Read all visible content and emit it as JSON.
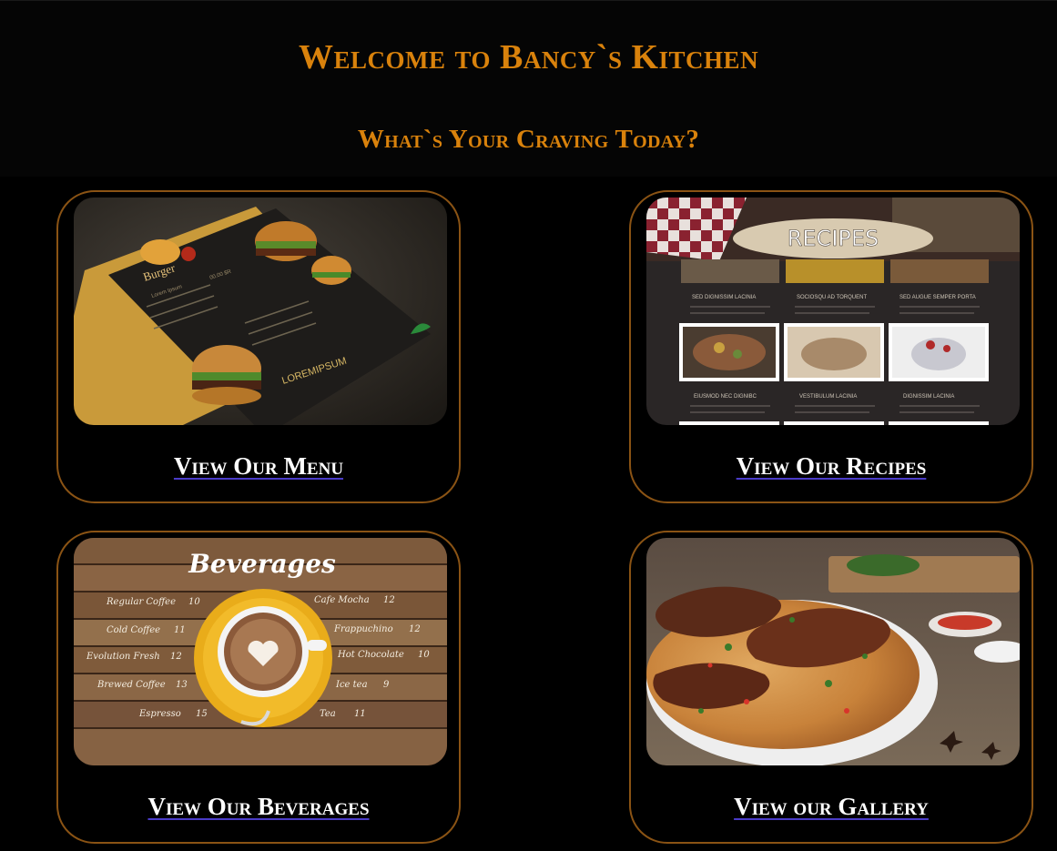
{
  "header": {
    "title": "Welcome to Bancy`s Kitchen",
    "subtitle": "What`s Your Craving Today?"
  },
  "cards": [
    {
      "label": "View Our Menu",
      "image_text": {
        "heading": "Burger",
        "brand": "LOREMIPSUM",
        "item": "Lorem Ipsum",
        "price": "00.00 $R"
      }
    },
    {
      "label": "View Our Recipes",
      "image_text": {
        "heading": "RECIPES",
        "captions": [
          "SED DIGNISSIM LACINIA",
          "SOCIOSQU AD TORQUENT",
          "SED AUGUE SEMPER PORTA",
          "EIUSMOD NEC DIGNIBC",
          "VESTIBULUM LACINIA",
          "DIGNISSIM LACINIA"
        ]
      }
    },
    {
      "label": "View Our Beverages",
      "image_text": {
        "heading": "Beverages",
        "items_left": [
          {
            "name": "Regular Coffee",
            "price": "10"
          },
          {
            "name": "Cold Coffee",
            "price": "11"
          },
          {
            "name": "Evolution Fresh",
            "price": "12"
          },
          {
            "name": "Brewed Coffee",
            "price": "13"
          },
          {
            "name": "Espresso",
            "price": "15"
          }
        ],
        "items_right": [
          {
            "name": "Cafe Mocha",
            "price": "12"
          },
          {
            "name": "Frappuchino",
            "price": "12"
          },
          {
            "name": "Hot Chocolate",
            "price": "10"
          },
          {
            "name": "Ice tea",
            "price": "9"
          },
          {
            "name": "Tea",
            "price": "11"
          }
        ]
      }
    },
    {
      "label": "View our Gallery"
    }
  ],
  "colors": {
    "accent": "#d9820c",
    "card_border": "#8a5314",
    "link_underline": "#4b3cc8",
    "background": "#000000"
  }
}
